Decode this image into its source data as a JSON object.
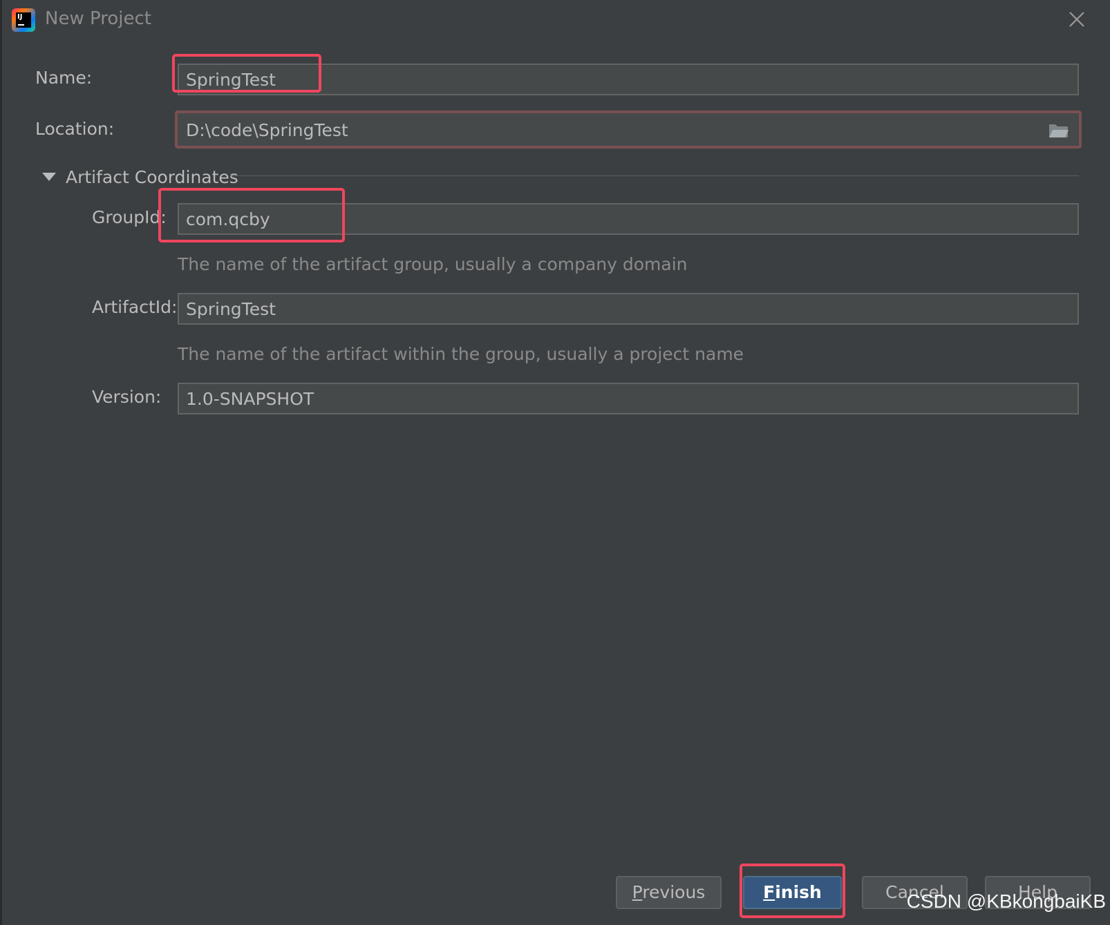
{
  "window": {
    "title": "New Project"
  },
  "form": {
    "name_label": "Name:",
    "name_value": "SpringTest",
    "location_label": "Location:",
    "location_value": "D:\\code\\SpringTest",
    "section_title": "Artifact Coordinates",
    "groupid_label": "GroupId:",
    "groupid_value": "com.qcby",
    "groupid_hint": "The name of the artifact group, usually a company domain",
    "artifactid_label": "ArtifactId:",
    "artifactid_value": "SpringTest",
    "artifactid_hint": "The name of the artifact within the group, usually a project name",
    "version_label": "Version:",
    "version_value": "1.0-SNAPSHOT"
  },
  "buttons": {
    "previous_mnemonic": "P",
    "previous_rest": "revious",
    "finish_mnemonic": "F",
    "finish_rest": "inish",
    "cancel": "Cancel",
    "help": "Help"
  },
  "watermark": "CSDN @KBkongbaiKB",
  "icons": {
    "app": "intellij-idea-icon",
    "close": "close-icon",
    "folder": "folder-icon",
    "collapse": "triangle-down-icon"
  },
  "colors": {
    "background": "#3c3f41",
    "field": "#45494a",
    "highlight": "#f0465f",
    "default_button": "#365880"
  }
}
